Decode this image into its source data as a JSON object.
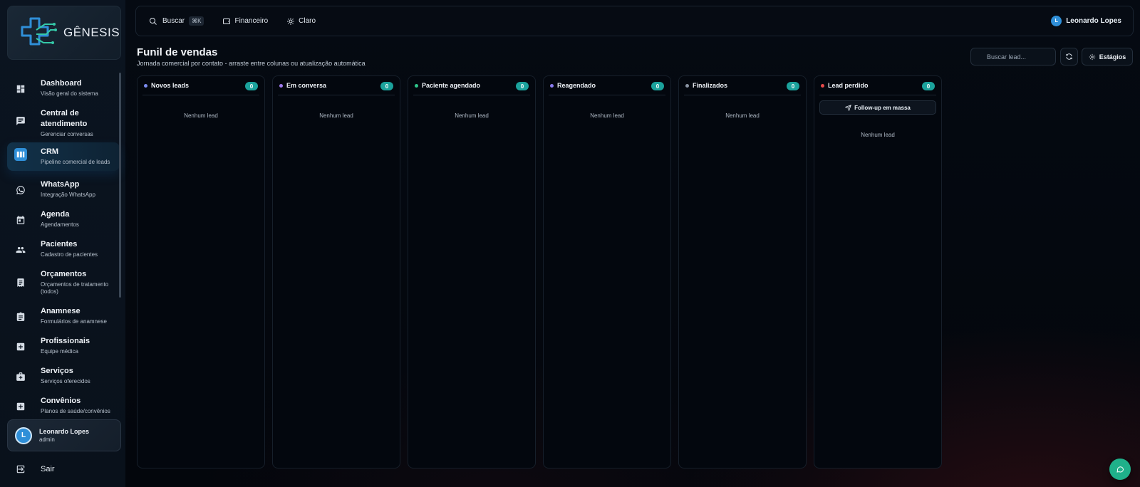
{
  "app": {
    "logo_text": "GÊNESIS"
  },
  "sidebar": {
    "items": [
      {
        "title": "Dashboard",
        "subtitle": "Visão geral do sistema",
        "icon": "dashboard-icon"
      },
      {
        "title": "Central de atendimento",
        "subtitle": "Gerenciar conversas",
        "icon": "chat-icon"
      },
      {
        "title": "CRM",
        "subtitle": "Pipeline comercial de leads",
        "icon": "kanban-icon",
        "active": true
      },
      {
        "title": "WhatsApp",
        "subtitle": "Integração WhatsApp",
        "icon": "whatsapp-icon"
      },
      {
        "title": "Agenda",
        "subtitle": "Agendamentos",
        "icon": "calendar-icon"
      },
      {
        "title": "Pacientes",
        "subtitle": "Cadastro de pacientes",
        "icon": "people-icon"
      },
      {
        "title": "Orçamentos",
        "subtitle": "Orçamentos de tratamento (todos)",
        "icon": "receipt-icon"
      },
      {
        "title": "Anamnese",
        "subtitle": "Formulários de anamnese",
        "icon": "clipboard-icon"
      },
      {
        "title": "Profissionais",
        "subtitle": "Equipe médica",
        "icon": "medical-plus-icon"
      },
      {
        "title": "Serviços",
        "subtitle": "Serviços oferecidos",
        "icon": "medkit-icon"
      },
      {
        "title": "Convênios",
        "subtitle": "Planos de saúde/convênios",
        "icon": "health-plan-icon"
      }
    ],
    "user": {
      "initial": "L",
      "name": "Leonardo Lopes",
      "role": "admin"
    },
    "logout_label": "Sair"
  },
  "topbar": {
    "search_label": "Buscar",
    "search_shortcut": "⌘K",
    "finance_label": "Financeiro",
    "theme_label": "Claro",
    "user_initial": "L",
    "user_name": "Leonardo Lopes"
  },
  "page": {
    "title": "Funil de vendas",
    "subtitle": "Jornada comercial por contato - arraste entre colunas ou atualização automática",
    "search_placeholder": "Buscar lead...",
    "stages_label": "Estágios"
  },
  "columns": [
    {
      "title": "Novos leads",
      "count": "0",
      "empty": "Nenhum lead",
      "dot_color": "#7c8cf0"
    },
    {
      "title": "Em conversa",
      "count": "0",
      "empty": "Nenhum lead",
      "dot_color": "#a07cf0"
    },
    {
      "title": "Paciente agendado",
      "count": "0",
      "empty": "Nenhum lead",
      "dot_color": "#2fc48a"
    },
    {
      "title": "Reagendado",
      "count": "0",
      "empty": "Nenhum lead",
      "dot_color": "#8a7cf0"
    },
    {
      "title": "Finalizados",
      "count": "0",
      "empty": "Nenhum lead",
      "dot_color": "#8a94a3"
    },
    {
      "title": "Lead perdido",
      "count": "0",
      "empty": "Nenhum lead",
      "dot_color": "#e84a4a",
      "action": "Follow-up em massa"
    }
  ],
  "colors": {
    "accent": "#2f8fd8",
    "count_badge": "#1ba29c",
    "fab": "#1fb08a"
  }
}
